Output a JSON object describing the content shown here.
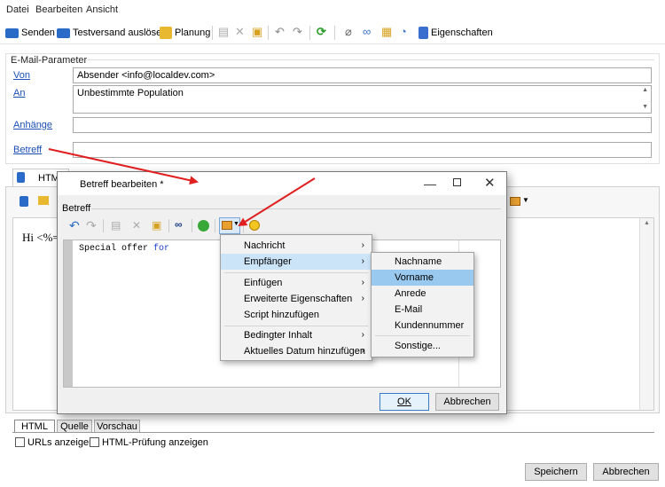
{
  "menubar": [
    "Datei",
    "Bearbeiten",
    "Ansicht"
  ],
  "toolbar": {
    "send": "Senden",
    "test_send": "Testversand auslösen",
    "planning": "Planung",
    "properties": "Eigenschaften"
  },
  "email_params": {
    "group_label": "E-Mail-Parameter",
    "from_label": "Von",
    "from_value": "Absender <info@localdev.com>",
    "to_label": "An",
    "to_value": "Unbestimmte Population",
    "attachments_label": "Anhänge",
    "subject_label": "Betreff"
  },
  "editor": {
    "html_tab": "HTM",
    "content_preview": "Hi <%=",
    "bottom_tabs": [
      "HTML",
      "Quelle",
      "Vorschau"
    ],
    "show_urls": "URLs anzeigen",
    "show_html_check": "HTML-Prüfung anzeigen"
  },
  "dialog": {
    "title": "Betreff bearbeiten *",
    "group_label": "Betreff",
    "text_prefix": "Special offer ",
    "text_keyword": "for",
    "ok": "OK",
    "cancel": "Abbrechen"
  },
  "context_menu": {
    "items": [
      {
        "label": "Nachricht",
        "submenu": true
      },
      {
        "label": "Empfänger",
        "submenu": true,
        "highlighted": true
      },
      {
        "label": "Einfügen",
        "submenu": true
      },
      {
        "label": "Erweiterte Eigenschaften",
        "submenu": true
      },
      {
        "label": "Script hinzufügen",
        "submenu": false
      },
      {
        "label": "Bedingter Inhalt",
        "submenu": true
      },
      {
        "label": "Aktuelles Datum hinzufügen",
        "submenu": true
      }
    ]
  },
  "submenu": {
    "items": [
      "Nachname",
      "Vorname",
      "Anrede",
      "E-Mail",
      "Kundennummer",
      "Sonstige..."
    ],
    "highlighted": "Vorname"
  },
  "footer": {
    "save": "Speichern",
    "cancel": "Abbrechen"
  },
  "colors": {
    "highlight": "#99c9ef",
    "link": "#1a4fb5",
    "arrow": "#e02020"
  }
}
